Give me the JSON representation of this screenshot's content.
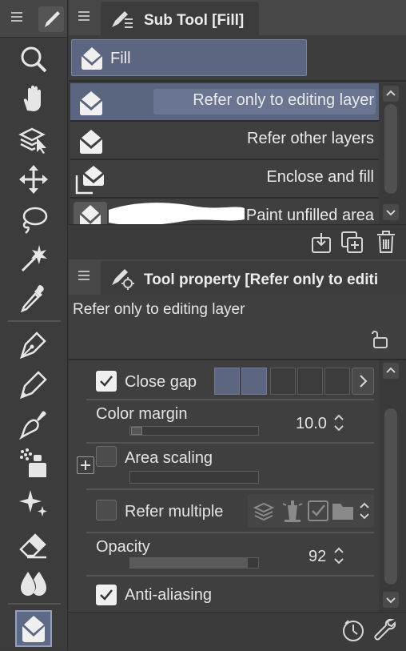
{
  "toolbar": {
    "icons": [
      "zoom-icon",
      "hand-icon",
      "select-layer-icon",
      "move-icon",
      "lasso-icon",
      "magic-wand-icon",
      "eyedropper-icon",
      "pen-icon",
      "pencil-icon",
      "brush-icon",
      "airbrush-icon",
      "decoration-icon",
      "eraser-icon",
      "blend-icon",
      "fill-icon"
    ],
    "selected": "fill-icon"
  },
  "subtool_panel": {
    "title": "Sub Tool [Fill]",
    "group_label": "Fill",
    "items": [
      {
        "label": "Refer only to editing layer",
        "selected": true
      },
      {
        "label": "Refer other layers",
        "selected": false
      },
      {
        "label": "Enclose and fill",
        "selected": false
      },
      {
        "label": "Paint unfilled area",
        "selected": false
      }
    ]
  },
  "property_panel": {
    "title": "Tool property [Refer only to editi",
    "subtitle": "Refer only to editing layer",
    "close_gap": {
      "label": "Close gap",
      "checked": true,
      "levels_on": 2,
      "levels_total": 5
    },
    "color_margin": {
      "label": "Color margin",
      "value": "10.0",
      "fraction": 0.0
    },
    "area_scaling": {
      "label": "Area scaling",
      "checked": false
    },
    "refer_multiple": {
      "label": "Refer multiple",
      "checked": false
    },
    "opacity": {
      "label": "Opacity",
      "value": "92",
      "fraction": 0.92
    },
    "anti_aliasing": {
      "label": "Anti-aliasing",
      "checked": true
    }
  },
  "colors": {
    "accent": "#5c6680",
    "panel": "#3f3f3f",
    "header": "#474747"
  }
}
